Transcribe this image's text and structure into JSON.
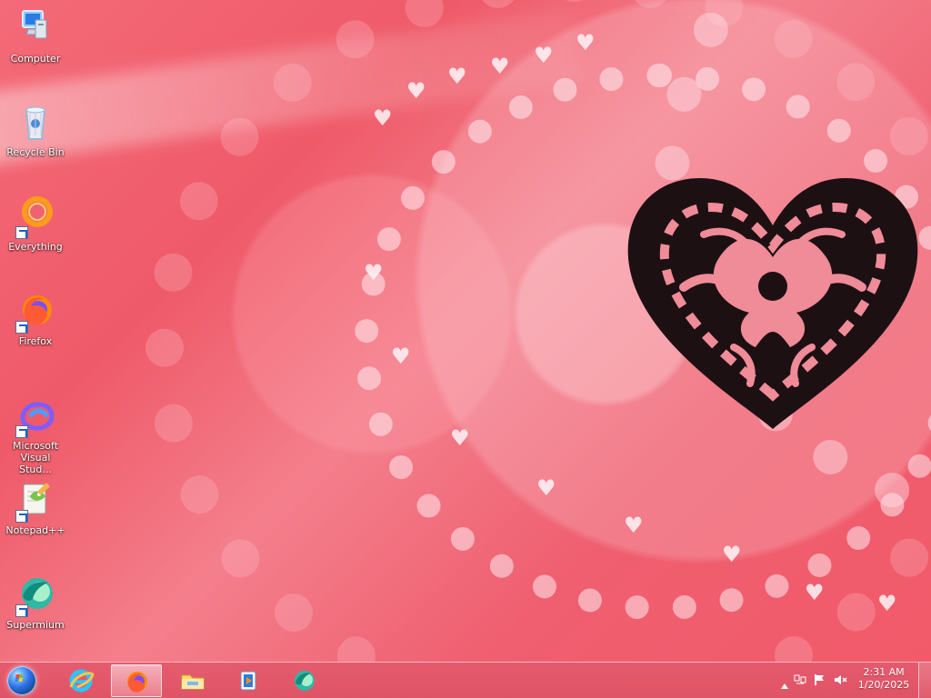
{
  "desktop": {
    "icons": [
      {
        "label": "Computer",
        "icon": "computer-icon",
        "shortcut": false
      },
      {
        "label": "Recycle Bin",
        "icon": "recycle-bin-icon",
        "shortcut": false
      },
      {
        "label": "Everything",
        "icon": "everything-icon",
        "shortcut": true
      },
      {
        "label": "Firefox",
        "icon": "firefox-icon",
        "shortcut": true
      },
      {
        "label": "Microsoft Visual Stud...",
        "icon": "visual-studio-icon",
        "shortcut": true
      },
      {
        "label": "Notepad++",
        "icon": "notepad-plus-plus-icon",
        "shortcut": true
      },
      {
        "label": "Supermium",
        "icon": "supermium-icon",
        "shortcut": true
      }
    ]
  },
  "taskbar": {
    "apps": [
      {
        "name": "Start",
        "icon": "windows-start-icon",
        "active": false
      },
      {
        "name": "Internet Explorer",
        "icon": "internet-explorer-icon",
        "active": false
      },
      {
        "name": "Firefox",
        "icon": "firefox-icon",
        "active": true
      },
      {
        "name": "File Explorer",
        "icon": "folder-icon",
        "active": false
      },
      {
        "name": "Windows Media Player",
        "icon": "media-player-icon",
        "active": false
      },
      {
        "name": "Supermium",
        "icon": "supermium-icon",
        "active": false
      }
    ],
    "tray": {
      "time": "2:31 AM",
      "date": "1/20/2025",
      "icons": [
        "show-hidden-icons-icon",
        "network-icon",
        "action-center-flag-icon",
        "volume-muted-icon"
      ]
    }
  },
  "colors": {
    "wallpaper_base": "#ef5a69",
    "wallpaper_light": "#f47f8c",
    "taskbar": "#de5466",
    "heart_dark": "#1b0d10"
  }
}
